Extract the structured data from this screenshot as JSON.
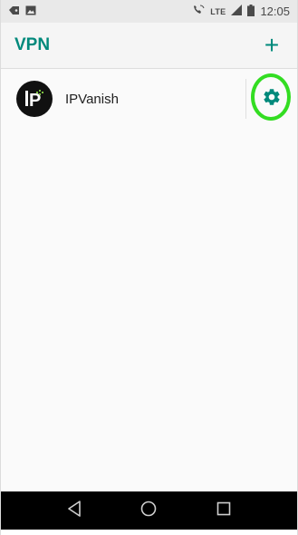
{
  "status_bar": {
    "network_label": "LTE",
    "time": "12:05"
  },
  "app_bar": {
    "title": "VPN",
    "add_label": "+"
  },
  "vpn_list": [
    {
      "name": "IPVanish"
    }
  ],
  "icons": {
    "status_left": [
      "tag-icon",
      "image-icon"
    ],
    "status_right": [
      "call-wifi-icon",
      "signal-icon",
      "battery-icon"
    ],
    "row": [
      "ipvanish-logo-icon",
      "gear-icon"
    ],
    "nav": [
      "back-icon",
      "home-icon",
      "recents-icon"
    ]
  },
  "colors": {
    "accent": "#00897b",
    "highlight": "#33dd22",
    "nav_bar": "#000000"
  }
}
